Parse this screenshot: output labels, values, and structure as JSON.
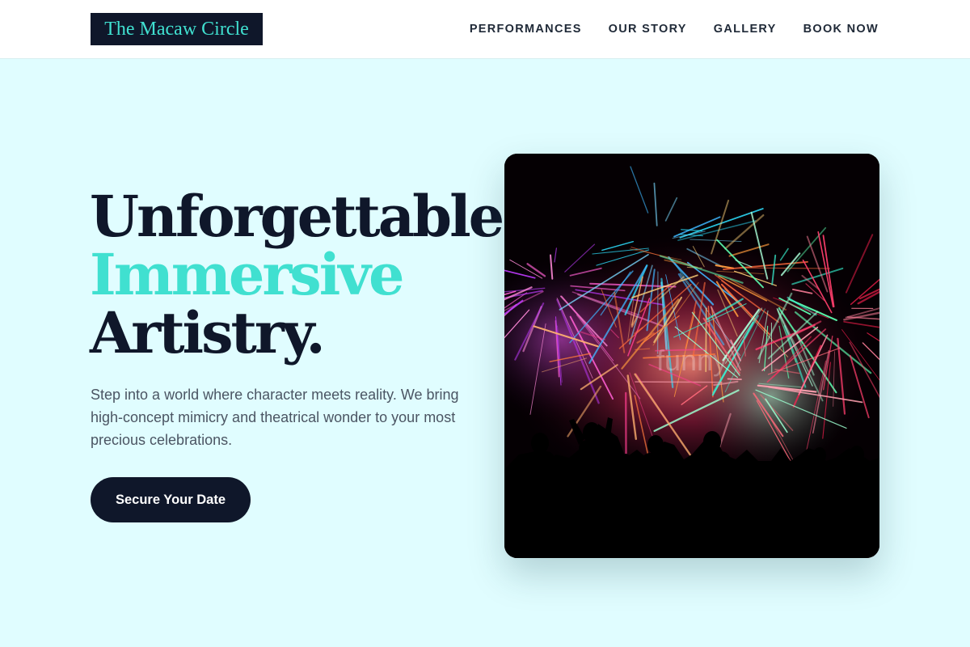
{
  "header": {
    "logo": "The Macaw Circle",
    "nav": [
      "PERFORMANCES",
      "OUR STORY",
      "GALLERY",
      "BOOK NOW"
    ]
  },
  "hero": {
    "headline_line1": "Unforgettable",
    "headline_line2": "Immersive",
    "headline_line3": "Artistry.",
    "description": "Step into a world where character meets reality. We bring high-concept mimicry and theatrical wonder to your most precious celebrations.",
    "cta_label": "Secure Your Date",
    "image_watermark": "funny"
  },
  "colors": {
    "brand_dark": "#0f172a",
    "accent_turquoise": "#40e0d0",
    "page_background": "#e0fdff",
    "body_text": "#4b5563"
  }
}
